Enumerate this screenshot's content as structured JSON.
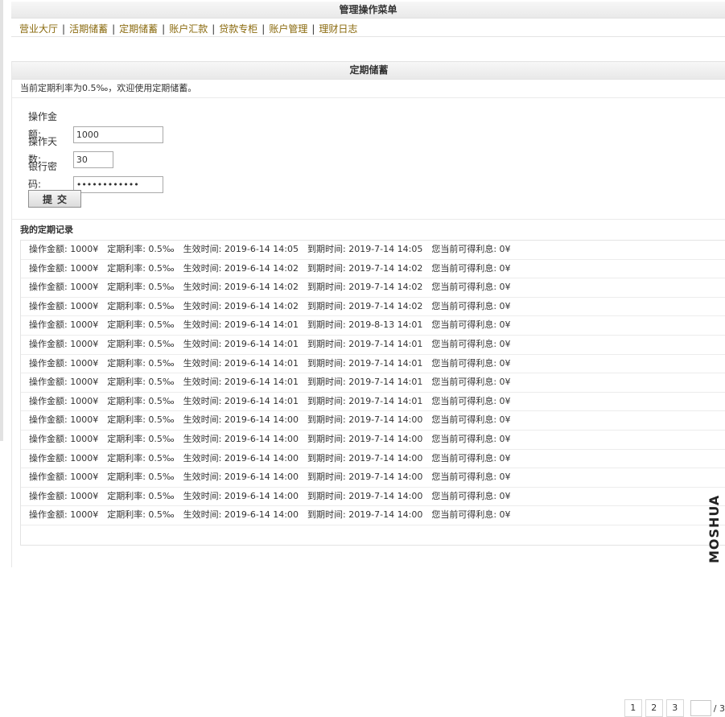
{
  "menu": {
    "title": "管理操作菜单",
    "items": [
      "营业大厅",
      "活期储蓄",
      "定期储蓄",
      "账户汇款",
      "贷款专柜",
      "账户管理",
      "理财日志"
    ],
    "separator": "|"
  },
  "fixed_deposit": {
    "title": "定期储蓄",
    "info": "当前定期利率为0.5‰，欢迎使用定期储蓄。",
    "form": {
      "amount_label": "操作金额:",
      "amount_value": "1000",
      "days_label": "操作天数:",
      "days_value": "30",
      "password_label": "银行密码:",
      "password_value": "••••••••••••",
      "submit_label": "提交"
    },
    "records_title": "我的定期记录",
    "records": [
      {
        "amount": "操作金额: 1000¥",
        "rate": "定期利率: 0.5‰",
        "start": "生效时间: 2019-6-14 14:05",
        "end": "到期时间: 2019-7-14 14:05",
        "interest": "您当前可得利息: 0¥"
      },
      {
        "amount": "操作金额: 1000¥",
        "rate": "定期利率: 0.5‰",
        "start": "生效时间: 2019-6-14 14:02",
        "end": "到期时间: 2019-7-14 14:02",
        "interest": "您当前可得利息: 0¥"
      },
      {
        "amount": "操作金额: 1000¥",
        "rate": "定期利率: 0.5‰",
        "start": "生效时间: 2019-6-14 14:02",
        "end": "到期时间: 2019-7-14 14:02",
        "interest": "您当前可得利息: 0¥"
      },
      {
        "amount": "操作金额: 1000¥",
        "rate": "定期利率: 0.5‰",
        "start": "生效时间: 2019-6-14 14:02",
        "end": "到期时间: 2019-7-14 14:02",
        "interest": "您当前可得利息: 0¥"
      },
      {
        "amount": "操作金额: 1000¥",
        "rate": "定期利率: 0.5‰",
        "start": "生效时间: 2019-6-14 14:01",
        "end": "到期时间: 2019-8-13 14:01",
        "interest": "您当前可得利息: 0¥"
      },
      {
        "amount": "操作金额: 1000¥",
        "rate": "定期利率: 0.5‰",
        "start": "生效时间: 2019-6-14 14:01",
        "end": "到期时间: 2019-7-14 14:01",
        "interest": "您当前可得利息: 0¥"
      },
      {
        "amount": "操作金额: 1000¥",
        "rate": "定期利率: 0.5‰",
        "start": "生效时间: 2019-6-14 14:01",
        "end": "到期时间: 2019-7-14 14:01",
        "interest": "您当前可得利息: 0¥"
      },
      {
        "amount": "操作金额: 1000¥",
        "rate": "定期利率: 0.5‰",
        "start": "生效时间: 2019-6-14 14:01",
        "end": "到期时间: 2019-7-14 14:01",
        "interest": "您当前可得利息: 0¥"
      },
      {
        "amount": "操作金额: 1000¥",
        "rate": "定期利率: 0.5‰",
        "start": "生效时间: 2019-6-14 14:01",
        "end": "到期时间: 2019-7-14 14:01",
        "interest": "您当前可得利息: 0¥"
      },
      {
        "amount": "操作金额: 1000¥",
        "rate": "定期利率: 0.5‰",
        "start": "生效时间: 2019-6-14 14:00",
        "end": "到期时间: 2019-7-14 14:00",
        "interest": "您当前可得利息: 0¥"
      },
      {
        "amount": "操作金额: 1000¥",
        "rate": "定期利率: 0.5‰",
        "start": "生效时间: 2019-6-14 14:00",
        "end": "到期时间: 2019-7-14 14:00",
        "interest": "您当前可得利息: 0¥"
      },
      {
        "amount": "操作金额: 1000¥",
        "rate": "定期利率: 0.5‰",
        "start": "生效时间: 2019-6-14 14:00",
        "end": "到期时间: 2019-7-14 14:00",
        "interest": "您当前可得利息: 0¥"
      },
      {
        "amount": "操作金额: 1000¥",
        "rate": "定期利率: 0.5‰",
        "start": "生效时间: 2019-6-14 14:00",
        "end": "到期时间: 2019-7-14 14:00",
        "interest": "您当前可得利息: 0¥"
      },
      {
        "amount": "操作金额: 1000¥",
        "rate": "定期利率: 0.5‰",
        "start": "生效时间: 2019-6-14 14:00",
        "end": "到期时间: 2019-7-14 14:00",
        "interest": "您当前可得利息: 0¥"
      },
      {
        "amount": "操作金额: 1000¥",
        "rate": "定期利率: 0.5‰",
        "start": "生效时间: 2019-6-14 14:00",
        "end": "到期时间: 2019-7-14 14:00",
        "interest": "您当前可得利息: 0¥"
      }
    ],
    "pagination": {
      "pages": [
        "1",
        "2",
        "3"
      ],
      "current_input": "",
      "total": "/ 3"
    }
  },
  "watermark": "MOSHUA"
}
